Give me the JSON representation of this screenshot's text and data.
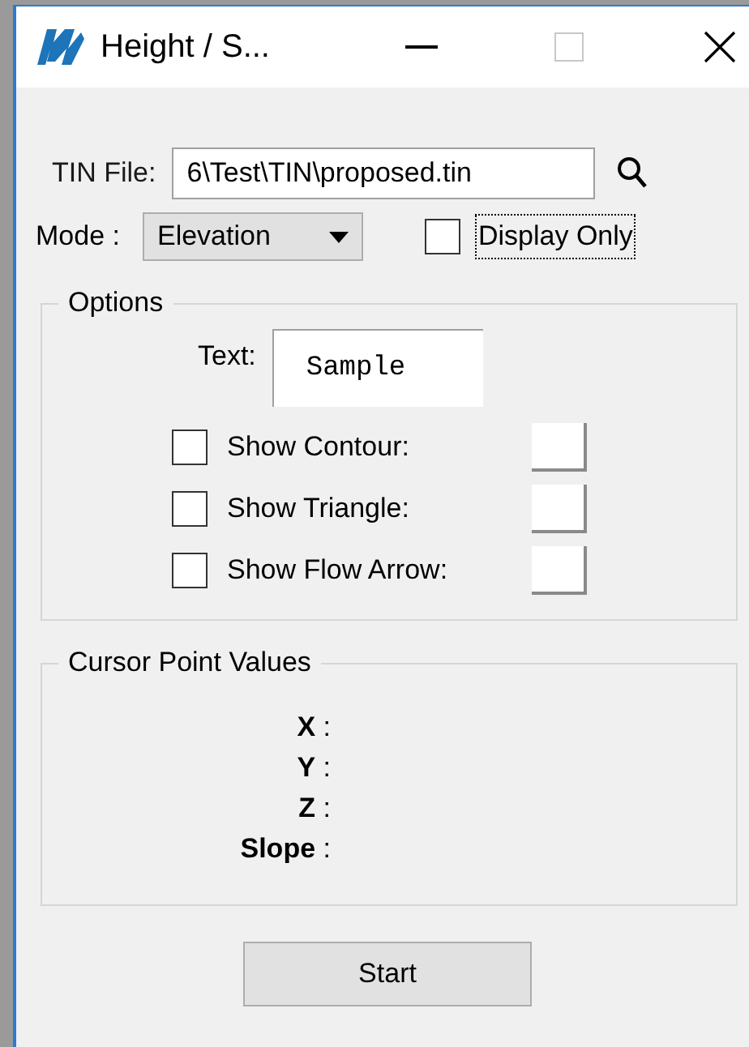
{
  "window": {
    "title": "Height / S..."
  },
  "tin_file": {
    "label": "TIN File:",
    "value": "6\\Test\\TIN\\proposed.tin"
  },
  "mode": {
    "label": "Mode :",
    "value": "Elevation"
  },
  "display_only": {
    "label": "Display Only",
    "checked": false,
    "focused": true
  },
  "options": {
    "legend": "Options",
    "text_label": "Text:",
    "text_value": "Sample",
    "items": [
      {
        "label": "Show Contour:",
        "checked": false
      },
      {
        "label": "Show Triangle:",
        "checked": false
      },
      {
        "label": "Show Flow Arrow:",
        "checked": false
      }
    ]
  },
  "cursor": {
    "legend": "Cursor Point Values",
    "values": [
      "**X** :",
      "**Y** :",
      "**Z** :",
      "**Slope** :"
    ]
  },
  "start_button": "Start"
}
